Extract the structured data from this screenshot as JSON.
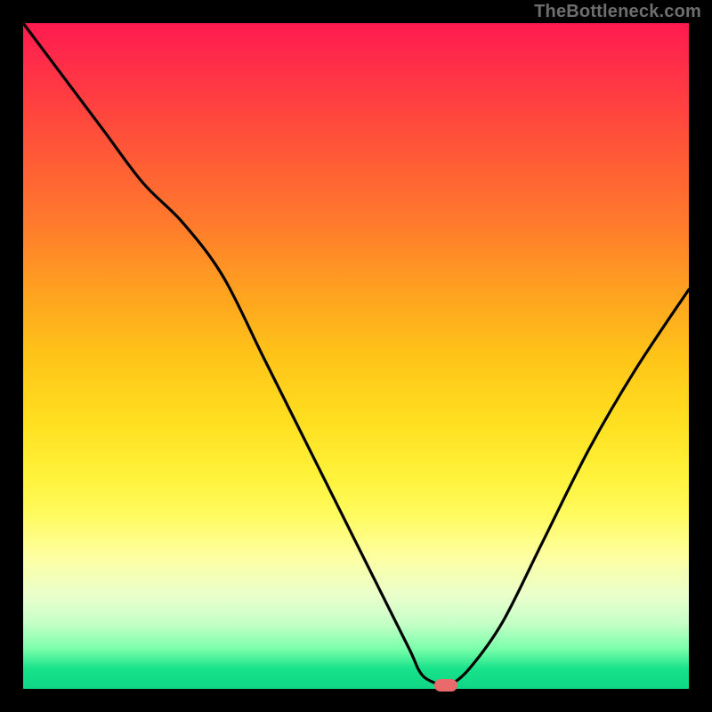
{
  "watermark": "TheBottleneck.com",
  "colors": {
    "frame": "#000000",
    "curve": "#000000",
    "marker": "#e86a6a",
    "gradient_stops": [
      "#ff1a4f",
      "#ff2a4a",
      "#ff4040",
      "#ff5a36",
      "#ff7a2c",
      "#ffa020",
      "#ffc418",
      "#ffe020",
      "#fff23a",
      "#fffb60",
      "#fdffa0",
      "#eaffcc",
      "#c8ffc8",
      "#7affaa",
      "#18e28a",
      "#0fd686"
    ]
  },
  "chart_data": {
    "type": "line",
    "title": "",
    "xlabel": "",
    "ylabel": "",
    "xlim": [
      0,
      100
    ],
    "ylim": [
      0,
      100
    ],
    "grid": false,
    "legend": false,
    "series": [
      {
        "name": "bottleneck-curve",
        "x": [
          0,
          6,
          12,
          18,
          24,
          30,
          36,
          42,
          48,
          54,
          58,
          60,
          63,
          64,
          67,
          72,
          78,
          85,
          92,
          100
        ],
        "values": [
          100,
          92,
          84,
          76,
          70,
          62,
          50,
          38,
          26,
          14,
          6,
          2,
          0.5,
          0.5,
          3,
          10,
          22,
          36,
          48,
          60
        ]
      }
    ],
    "marker": {
      "x": 63.5,
      "y": 0.5
    },
    "background_metric": "score-gradient-100-to-0"
  }
}
